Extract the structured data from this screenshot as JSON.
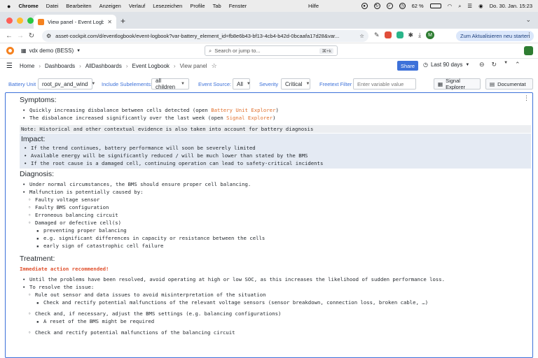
{
  "menubar": {
    "app": "Chrome",
    "items": [
      "Datei",
      "Bearbeiten",
      "Anzeigen",
      "Verlauf",
      "Lesezeichen",
      "Profile",
      "Tab",
      "Fenster"
    ],
    "center": "Hilfe",
    "battery": "62 %",
    "datetime": "Do. 30. Jan.  15:23"
  },
  "browser": {
    "tab_title": "View panel - Event Logbook",
    "url": "asset-cockpit.com/d/eventlogbook/event-logbook?var-battery_element_id=fb8e6b43-bf13-4cb4-b42d-0bcaafa17d28&var...",
    "profile_initial": "M",
    "update_button": "Zum Aktualisieren neu starten"
  },
  "grafana": {
    "org": "vdx demo (BESS)",
    "search_placeholder": "Search or jump to...",
    "search_shortcut": "⌘+k",
    "breadcrumbs": [
      "Home",
      "Dashboards",
      "AllDashboards",
      "Event Logbook",
      "View panel"
    ],
    "share": "Share",
    "time_range": "Last 90 days"
  },
  "variables": {
    "battery_unit_label": "Battery Unit",
    "battery_unit_value": "root_pv_and_wind",
    "subelements_label": "Include Subelements:",
    "subelements_value": "all children",
    "event_source_label": "Event Source:",
    "event_source_value": "All",
    "severity_label": "Severity",
    "severity_value": "Critical",
    "freetext_label": "Freetext Filter",
    "freetext_placeholder": "Enter variable value",
    "signal_explorer": "Signal Explorer",
    "documentation": "Documentat"
  },
  "panel": {
    "symptoms_title": "Symptoms:",
    "symptom1_prefix": "Quickly increasing disbalance between cells detected (open ",
    "symptom1_link": "Battery Unit Explorer",
    "symptom1_suffix": ")",
    "symptom2_prefix": "The disbalance increased significantly over the last week (open ",
    "symptom2_link": "Signal Explorer",
    "symptom2_suffix": ")",
    "note": "Note: Historical and other contextual evidence is also taken into account for battery diagnosis",
    "impact_title": "Impact:",
    "impact": [
      "If the trend continues, battery performance will soon be severely limited",
      "Available energy will be significantly reduced / will be much lower than stated by the BMS",
      "If the root cause is a damaged cell, continuing operation can lead to safety-critical incidents"
    ],
    "diagnosis_title": "Diagnosis:",
    "diag1": "Under normal circumstances, the BMS should ensure proper cell balancing.",
    "diag2": "Malfunction is potentially caused by:",
    "causes": [
      "Faulty voltage sensor",
      "Faulty BMS configuration",
      "Erroneous balancing circuit",
      "Damaged or defective cell(s)"
    ],
    "cell_details": [
      "preventing proper balancing",
      "e.g. significant differences in capacity or resistance between the cells",
      "early sign of catastrophic cell failure"
    ],
    "treatment_title": "Treatment:",
    "warning": "Immediate action recommended!",
    "treat1": "Until the problems have been resolved, avoid operating at high or low SOC, as this increases the likelihood of sudden performance loss.",
    "treat2": "To resolve the issue:",
    "step1": "Rule out sensor and data issues to avoid misinterpretation of the situation",
    "step1_sub": "Check and rectify potential malfunctions of the relevant voltage sensors (sensor breakdown, connection loss, broken cable, …)",
    "step2": "Check and, if necessary, adjust the BMS settings (e.g. balancing configurations)",
    "step2_sub": "A reset of the BMS might be required",
    "step3": "Check and rectify potential malfunctions of the balancing circuit"
  }
}
